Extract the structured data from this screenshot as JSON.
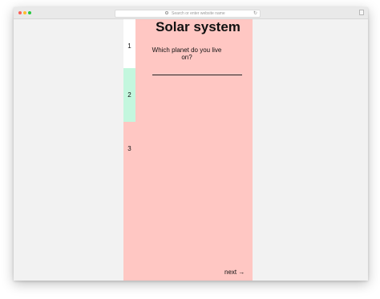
{
  "browser": {
    "address_placeholder": "Search or enter website name"
  },
  "quiz": {
    "title": "Solar system",
    "steps": [
      {
        "label": "1"
      },
      {
        "label": "2"
      },
      {
        "label": "3"
      }
    ],
    "question": "Which planet do you live on?",
    "answer_value": "",
    "next_label": "next →"
  },
  "colors": {
    "quiz_background": "#ffc7c3",
    "active_step": "#c3f7de",
    "first_step": "#ffffff",
    "page_background": "#f2f2f2"
  },
  "icons": {
    "search": "search-icon",
    "reload": "reload-icon",
    "share": "share-icon"
  }
}
